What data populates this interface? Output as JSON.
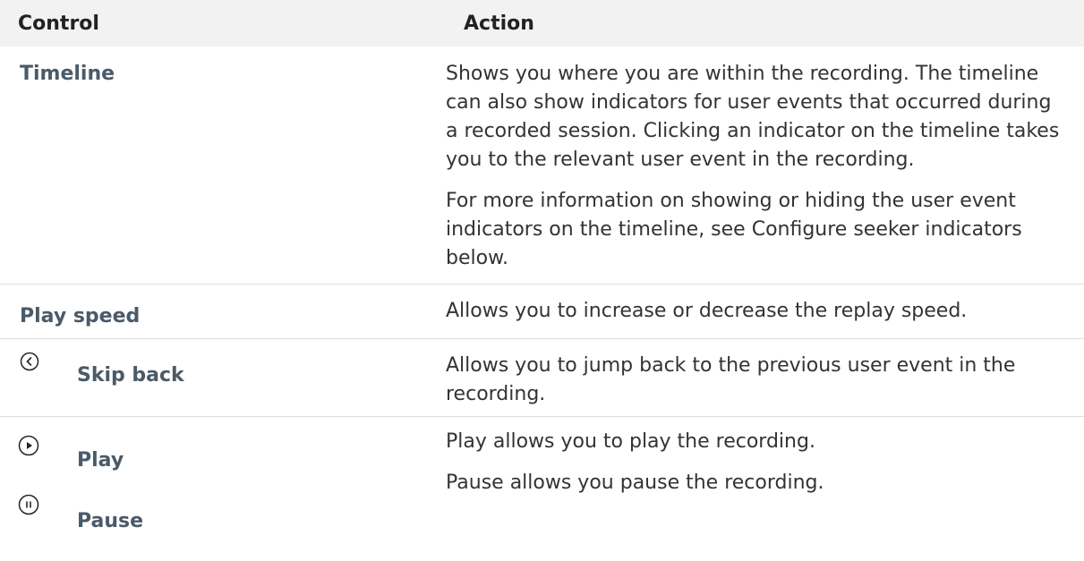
{
  "table": {
    "headers": {
      "control": "Control",
      "action": "Action"
    },
    "rows": {
      "timeline": {
        "control": "Timeline",
        "action_p1": "Shows you where you are within the recording. The timeline can also show indicators for user events that occurred during a recorded session. Clicking an indicator on the timeline takes you to the relevant user event in the recording.",
        "action_p2": "For more information on showing or hiding the user event indicators on the timeline, see Configure seeker indicators below."
      },
      "play_speed": {
        "control": "Play speed",
        "action": "Allows you to increase or decrease the replay speed."
      },
      "skip_back": {
        "control": "Skip back",
        "icon": "chevron-left-circle-icon",
        "action": "Allows you to jump back to the previous user event in the recording."
      },
      "play_pause": {
        "play_control": "Play",
        "play_icon": "play-circle-icon",
        "pause_control": "Pause",
        "pause_icon": "pause-circle-icon",
        "action_p1": "Play allows you to play the recording.",
        "action_p2": "Pause allows you pause the recording."
      }
    }
  },
  "colors": {
    "control_text": "#4a5a68",
    "body_text": "#333333",
    "header_bg": "#f2f2f2",
    "row_border": "#dedede"
  }
}
